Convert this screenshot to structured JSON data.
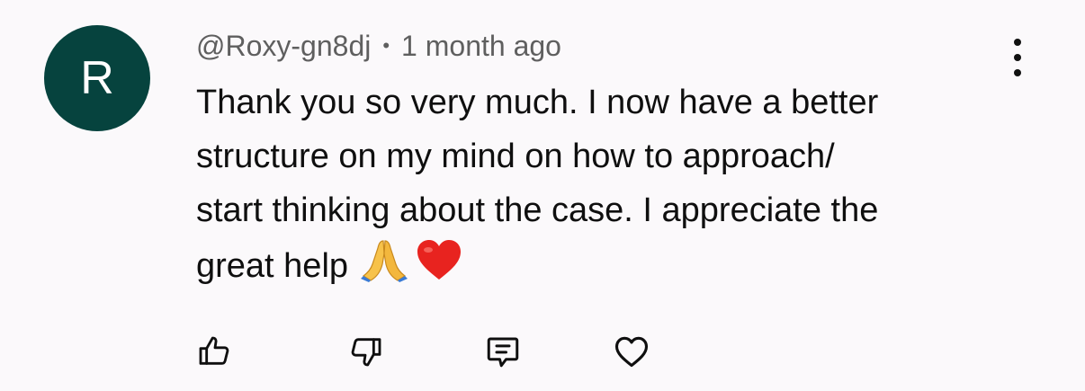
{
  "comment": {
    "avatar_letter": "R",
    "avatar_color": "#06433e",
    "author": "@Roxy-gn8dj",
    "separator": "•",
    "timestamp": "1 month ago",
    "text_lines": [
      "Thank you so very much. I now have a better",
      "structure on my mind on how to approach/",
      "start thinking about the case. I appreciate the",
      "great help"
    ],
    "emojis": [
      "folded-hands-emoji",
      "red-heart-emoji"
    ]
  },
  "actions": {
    "like_icon": "thumbs-up-icon",
    "dislike_icon": "thumbs-down-icon",
    "reply_icon": "comment-icon",
    "heart_icon": "heart-icon",
    "menu_icon": "more-vertical-icon"
  }
}
